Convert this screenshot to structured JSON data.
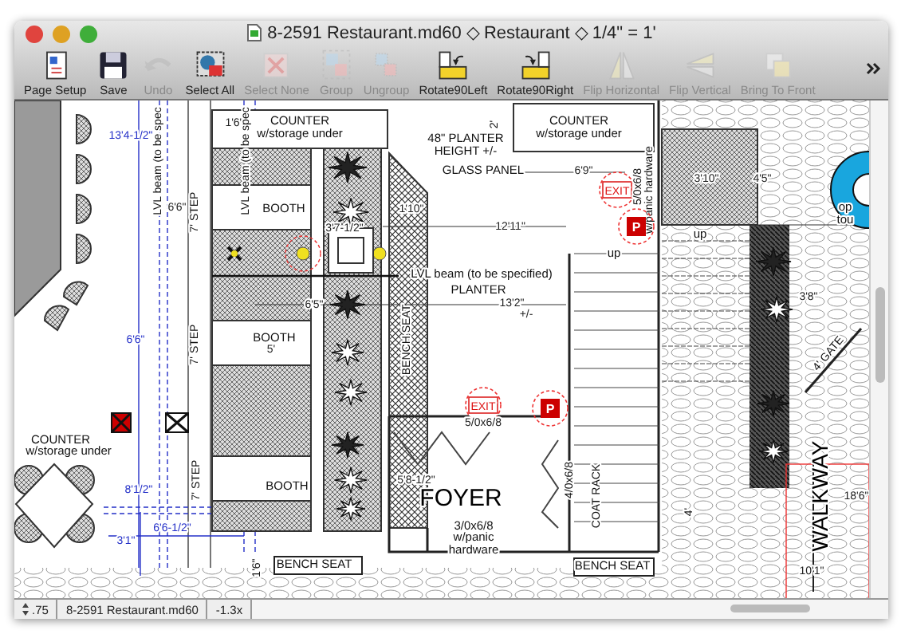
{
  "window": {
    "title": "8-2591 Restaurant.md60 ◇ Restaurant ◇ 1/4\" = 1'"
  },
  "toolbar": {
    "buttons": [
      {
        "label": "Page Setup",
        "disabled": false
      },
      {
        "label": "Save",
        "disabled": false
      },
      {
        "label": "Undo",
        "disabled": true
      },
      {
        "label": "Select All",
        "disabled": false
      },
      {
        "label": "Select None",
        "disabled": true
      },
      {
        "label": "Group",
        "disabled": true
      },
      {
        "label": "Ungroup",
        "disabled": true
      },
      {
        "label": "Rotate90Left",
        "disabled": false
      },
      {
        "label": "Rotate90Right",
        "disabled": false
      },
      {
        "label": "Flip Horizontal",
        "disabled": true
      },
      {
        "label": "Flip Vertical",
        "disabled": true
      },
      {
        "label": "Bring To Front",
        "disabled": true
      }
    ]
  },
  "plan": {
    "labels": [
      {
        "text": "13'4-1/2\"",
        "kind": "blue"
      },
      {
        "text": "1'6\"",
        "kind": "dim"
      },
      {
        "text": "COUNTER",
        "kind": "text"
      },
      {
        "text": "w/storage under",
        "kind": "text"
      },
      {
        "text": "48\" PLANTER",
        "kind": "text"
      },
      {
        "text": "HEIGHT +/-",
        "kind": "text"
      },
      {
        "text": "2'",
        "kind": "vertical"
      },
      {
        "text": "COUNTER",
        "kind": "text"
      },
      {
        "text": "w/storage under",
        "kind": "text"
      },
      {
        "text": "LVL beam (to be spec",
        "kind": "vertical"
      },
      {
        "text": "LVL beam (to be spec",
        "kind": "vertical"
      },
      {
        "text": "GLASS PANEL",
        "kind": "text"
      },
      {
        "text": "6'9\"",
        "kind": "dim"
      },
      {
        "text": "EXIT",
        "kind": "exit"
      },
      {
        "text": "5/0x6/8",
        "kind": "vertical"
      },
      {
        "text": "w/panic hardware",
        "kind": "vertical"
      },
      {
        "text": "3'10\"",
        "kind": "dim"
      },
      {
        "text": "4'5\"",
        "kind": "dim"
      },
      {
        "text": "op",
        "kind": "text"
      },
      {
        "text": "tou",
        "kind": "text"
      },
      {
        "text": "6'6\"",
        "kind": "dim"
      },
      {
        "text": "7' STEP",
        "kind": "vertical"
      },
      {
        "text": "BOOTH",
        "kind": "text"
      },
      {
        "text": "1'10\"",
        "kind": "dim"
      },
      {
        "text": "3'7-1/2\"",
        "kind": "dim"
      },
      {
        "text": "12'11\"",
        "kind": "dim"
      },
      {
        "text": "P",
        "kind": "sign"
      },
      {
        "text": "up",
        "kind": "text"
      },
      {
        "text": "up",
        "kind": "text"
      },
      {
        "text": "LVL beam (to be specified)",
        "kind": "text"
      },
      {
        "text": "PLANTER",
        "kind": "text"
      },
      {
        "text": "6'5\"",
        "kind": "dim"
      },
      {
        "text": "13'2\"",
        "kind": "dim"
      },
      {
        "text": "+/-",
        "kind": "dim"
      },
      {
        "text": "3'8\"",
        "kind": "dim"
      },
      {
        "text": "6'6\"",
        "kind": "blue"
      },
      {
        "text": "7' STEP",
        "kind": "vertical"
      },
      {
        "text": "BOOTH",
        "kind": "text"
      },
      {
        "text": "5'",
        "kind": "dim"
      },
      {
        "text": "BENCH SEAT",
        "kind": "vertical"
      },
      {
        "text": "4' GATE",
        "kind": "diagonal"
      },
      {
        "text": "EXIT",
        "kind": "exit"
      },
      {
        "text": "5/0x6/8",
        "kind": "dim"
      },
      {
        "text": "P",
        "kind": "sign"
      },
      {
        "text": "COUNTER",
        "kind": "text"
      },
      {
        "text": "w/storage under",
        "kind": "text"
      },
      {
        "text": "8'1/2\"",
        "kind": "blue"
      },
      {
        "text": "7' STEP",
        "kind": "vertical"
      },
      {
        "text": "BOOTH",
        "kind": "text"
      },
      {
        "text": "5'8-1/2\"",
        "kind": "dim"
      },
      {
        "text": "FOYER",
        "kind": "title"
      },
      {
        "text": "4/0x6/8",
        "kind": "vertical"
      },
      {
        "text": "COAT RACK",
        "kind": "vertical"
      },
      {
        "text": "WALKWAY",
        "kind": "title_vertical"
      },
      {
        "text": "18'6\"",
        "kind": "dim"
      },
      {
        "text": "4'",
        "kind": "vertical"
      },
      {
        "text": "6'6-1/2\"",
        "kind": "blue"
      },
      {
        "text": "3'1\"",
        "kind": "blue"
      },
      {
        "text": "3/0x6/8",
        "kind": "text"
      },
      {
        "text": "w/panic",
        "kind": "text"
      },
      {
        "text": "hardware",
        "kind": "text"
      },
      {
        "text": "1'6\"",
        "kind": "vertical"
      },
      {
        "text": "BENCH SEAT",
        "kind": "text"
      },
      {
        "text": "BENCH SEAT",
        "kind": "text"
      },
      {
        "text": "10'1\"",
        "kind": "dim"
      }
    ]
  },
  "status_bar": {
    "zoom": ".75",
    "file": "8-2591 Restaurant.md60",
    "scale": "-1.3x"
  }
}
